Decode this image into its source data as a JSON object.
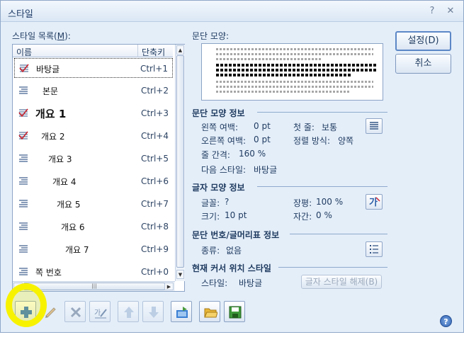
{
  "window": {
    "title": "스타일",
    "help_glyph": "?",
    "close_glyph": "✕"
  },
  "style_list": {
    "label": "스타일 목록(",
    "mnemonic": "M",
    "label_end": "):",
    "columns": {
      "name": "이름",
      "shortcut": "단축키"
    },
    "items": [
      {
        "name": "바탕글",
        "shortcut": "Ctrl+1",
        "icon": "style-check-icon"
      },
      {
        "name": "본문",
        "shortcut": "Ctrl+2",
        "icon": "paragraph-icon"
      },
      {
        "name": "개요 1",
        "shortcut": "Ctrl+3",
        "icon": "style-check-icon"
      },
      {
        "name": "개요 2",
        "shortcut": "Ctrl+4",
        "icon": "style-check-icon"
      },
      {
        "name": "개요 3",
        "shortcut": "Ctrl+5",
        "icon": "paragraph-icon"
      },
      {
        "name": "개요 4",
        "shortcut": "Ctrl+6",
        "icon": "paragraph-icon"
      },
      {
        "name": "개요 5",
        "shortcut": "Ctrl+7",
        "icon": "paragraph-icon"
      },
      {
        "name": "개요 6",
        "shortcut": "Ctrl+8",
        "icon": "paragraph-icon"
      },
      {
        "name": "개요 7",
        "shortcut": "Ctrl+9",
        "icon": "paragraph-icon"
      },
      {
        "name": "쪽 번호",
        "shortcut": "Ctrl+0",
        "icon": "paragraph-icon"
      }
    ]
  },
  "preview": {
    "label": "문단 모양:"
  },
  "paragraph_info": {
    "header": "문단 모양 정보",
    "left_margin_label": "왼쪽 여백:",
    "left_margin": "0 pt",
    "first_line_label": "첫 줄:",
    "first_line": "보통",
    "right_margin_label": "오른쪽 여백:",
    "right_margin": "0 pt",
    "align_label": "정렬 방식:",
    "align": "양쪽",
    "line_spacing_label": "줄 간격:",
    "line_spacing": "160 %",
    "next_style_label": "다음 스타일:",
    "next_style": "바탕글"
  },
  "char_info": {
    "header": "글자 모양 정보",
    "font_label": "글꼴:",
    "font": "?",
    "ratio_label": "장평:",
    "ratio": "100 %",
    "size_label": "크기:",
    "size": "10 pt",
    "spacing_label": "자간:",
    "spacing": "0 %"
  },
  "numbering_info": {
    "header": "문단 번호/글머리표 정보",
    "type_label": "종류:",
    "type": "없음"
  },
  "cursor_style": {
    "header": "현재 커서 위치 스타일",
    "style_label": "스타일:",
    "style": "바탕글",
    "release_button": "글자 스타일 해제(B)"
  },
  "buttons": {
    "ok": "설정(D)",
    "cancel": "취소"
  },
  "toolbar": [
    "add-style",
    "edit-style",
    "delete-style",
    "edit-style-detail",
    "move-up",
    "move-down",
    "import",
    "open",
    "save"
  ],
  "colors": {
    "highlight": "#f7f200",
    "accent": "#5c87c6"
  }
}
